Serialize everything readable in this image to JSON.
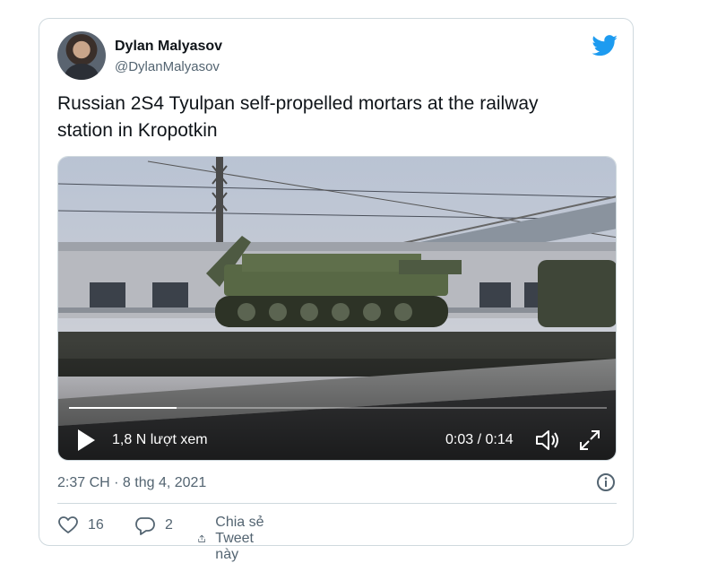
{
  "author": {
    "name": "Dylan Malyasov",
    "handle": "@DylanMalyasov"
  },
  "tweet": {
    "text_line1": "Russian 2S4 Tyulpan self-propelled mortars at the railway",
    "text_line2": "station in Kropotkin"
  },
  "video": {
    "views": "1,8 N lượt xem",
    "time": "0:03 / 0:14",
    "progress": 0.2
  },
  "timestamp": "2:37 CH · 8 thg 4, 2021",
  "actions": {
    "likes": "16",
    "replies": "2",
    "share_label": "Chia sẻ Tweet này"
  },
  "colors": {
    "brand": "#1d9bf0",
    "text_secondary": "#536471",
    "border": "#cfd9de"
  },
  "icons": [
    "twitter-bird-icon",
    "play-icon",
    "volume-icon",
    "fullscreen-icon",
    "info-icon",
    "heart-icon",
    "reply-icon",
    "share-icon"
  ]
}
